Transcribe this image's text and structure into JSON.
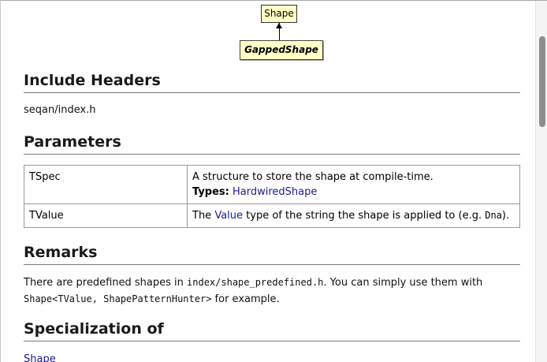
{
  "diagram": {
    "parent": "Shape",
    "child": "GappedShape"
  },
  "include_headers": {
    "heading": "Include Headers",
    "value": "seqan/index.h"
  },
  "parameters": {
    "heading": "Parameters",
    "rows": [
      {
        "name": "TSpec",
        "description": "A structure to store the shape at compile-time.",
        "types_label": "Types:",
        "types_value": "HardwiredShape"
      },
      {
        "name": "TValue",
        "desc_prefix": "The ",
        "desc_link": "Value",
        "desc_middle": " type of the string the shape is applied to (e.g. ",
        "desc_code": "Dna",
        "desc_suffix": ")."
      }
    ]
  },
  "remarks": {
    "heading": "Remarks",
    "line1_prefix": "There are predefined shapes in ",
    "line1_code": "index/shape_predefined.h",
    "line1_suffix": ". You can simply use them with",
    "line2_code": "Shape<TValue, ShapePatternHunter>",
    "line2_suffix": " for example."
  },
  "specialization": {
    "heading": "Specialization of",
    "link": "Shape"
  }
}
